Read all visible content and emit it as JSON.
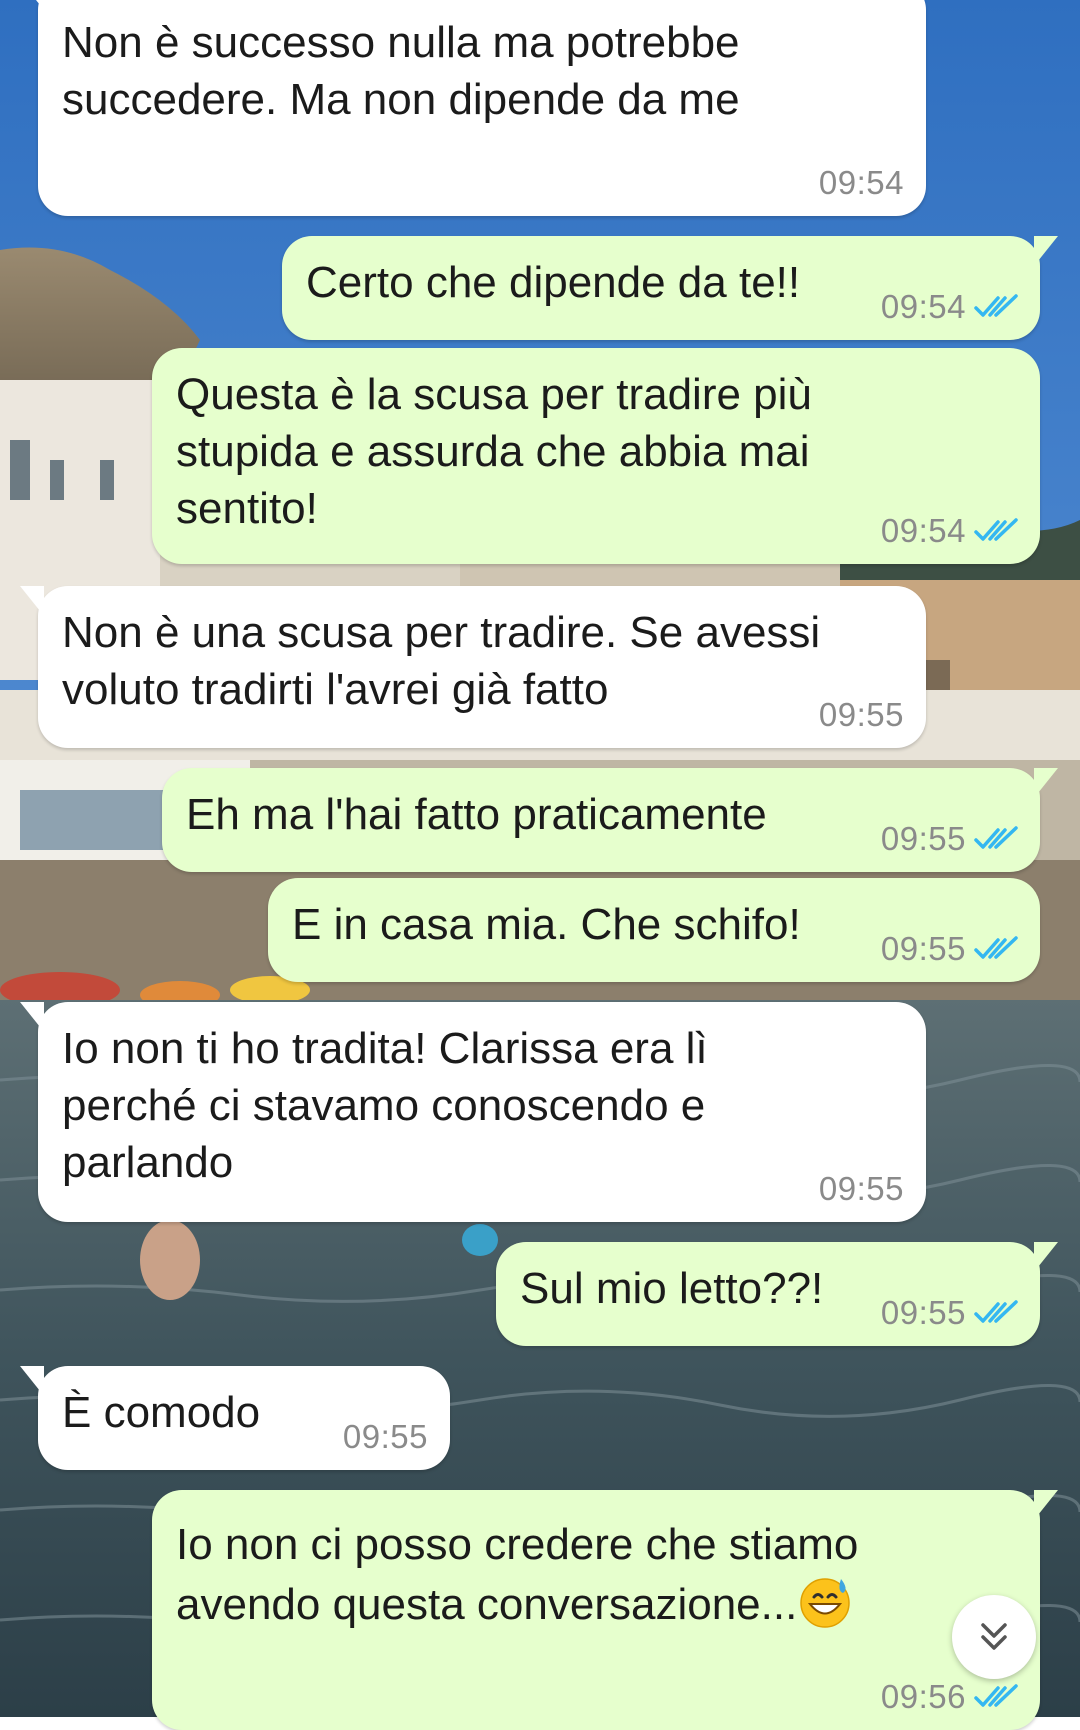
{
  "chat": {
    "messages": [
      {
        "id": "m1",
        "direction": "incoming",
        "text": "Non è successo nulla ma potrebbe\nsuccedere. Ma non dipende da me",
        "time": "09:54"
      },
      {
        "id": "m2",
        "direction": "outgoing",
        "text": "Certo che dipende da te!!",
        "time": "09:54",
        "status": "read"
      },
      {
        "id": "m3",
        "direction": "outgoing",
        "text": "Questa è la scusa per tradire più\nstupida e assurda che abbia mai\nsentito!",
        "time": "09:54",
        "status": "read"
      },
      {
        "id": "m4",
        "direction": "incoming",
        "text": "Non è una scusa per tradire. Se avessi\nvoluto tradirti l'avrei già fatto",
        "time": "09:55"
      },
      {
        "id": "m5",
        "direction": "outgoing",
        "text": "Eh ma l'hai fatto praticamente",
        "time": "09:55",
        "status": "read"
      },
      {
        "id": "m6",
        "direction": "outgoing",
        "text": "E in casa mia. Che schifo!",
        "time": "09:55",
        "status": "read"
      },
      {
        "id": "m7",
        "direction": "incoming",
        "text": "Io non ti ho tradita! Clarissa era lì\nperché ci stavamo conoscendo e\nparlando",
        "time": "09:55"
      },
      {
        "id": "m8",
        "direction": "outgoing",
        "text": "Sul mio letto??!",
        "time": "09:55",
        "status": "read"
      },
      {
        "id": "m9",
        "direction": "incoming",
        "text": "È comodo",
        "time": "09:55"
      },
      {
        "id": "m10",
        "direction": "outgoing",
        "text": "Io non ci posso credere che stiamo\navendo questa conversazione...",
        "emoji": "grinning-face-with-sweat",
        "time": "09:56",
        "status": "read"
      }
    ]
  },
  "colors": {
    "incoming_bubble": "#ffffff",
    "outgoing_bubble": "#e6ffcd",
    "read_ticks": "#34b7f1",
    "timestamp": "#8a8a8a"
  },
  "icons": {
    "read_receipt": "double-check-icon",
    "scroll_down": "double-chevron-down-icon",
    "emoji": "grinning-face-with-sweat-emoji"
  }
}
